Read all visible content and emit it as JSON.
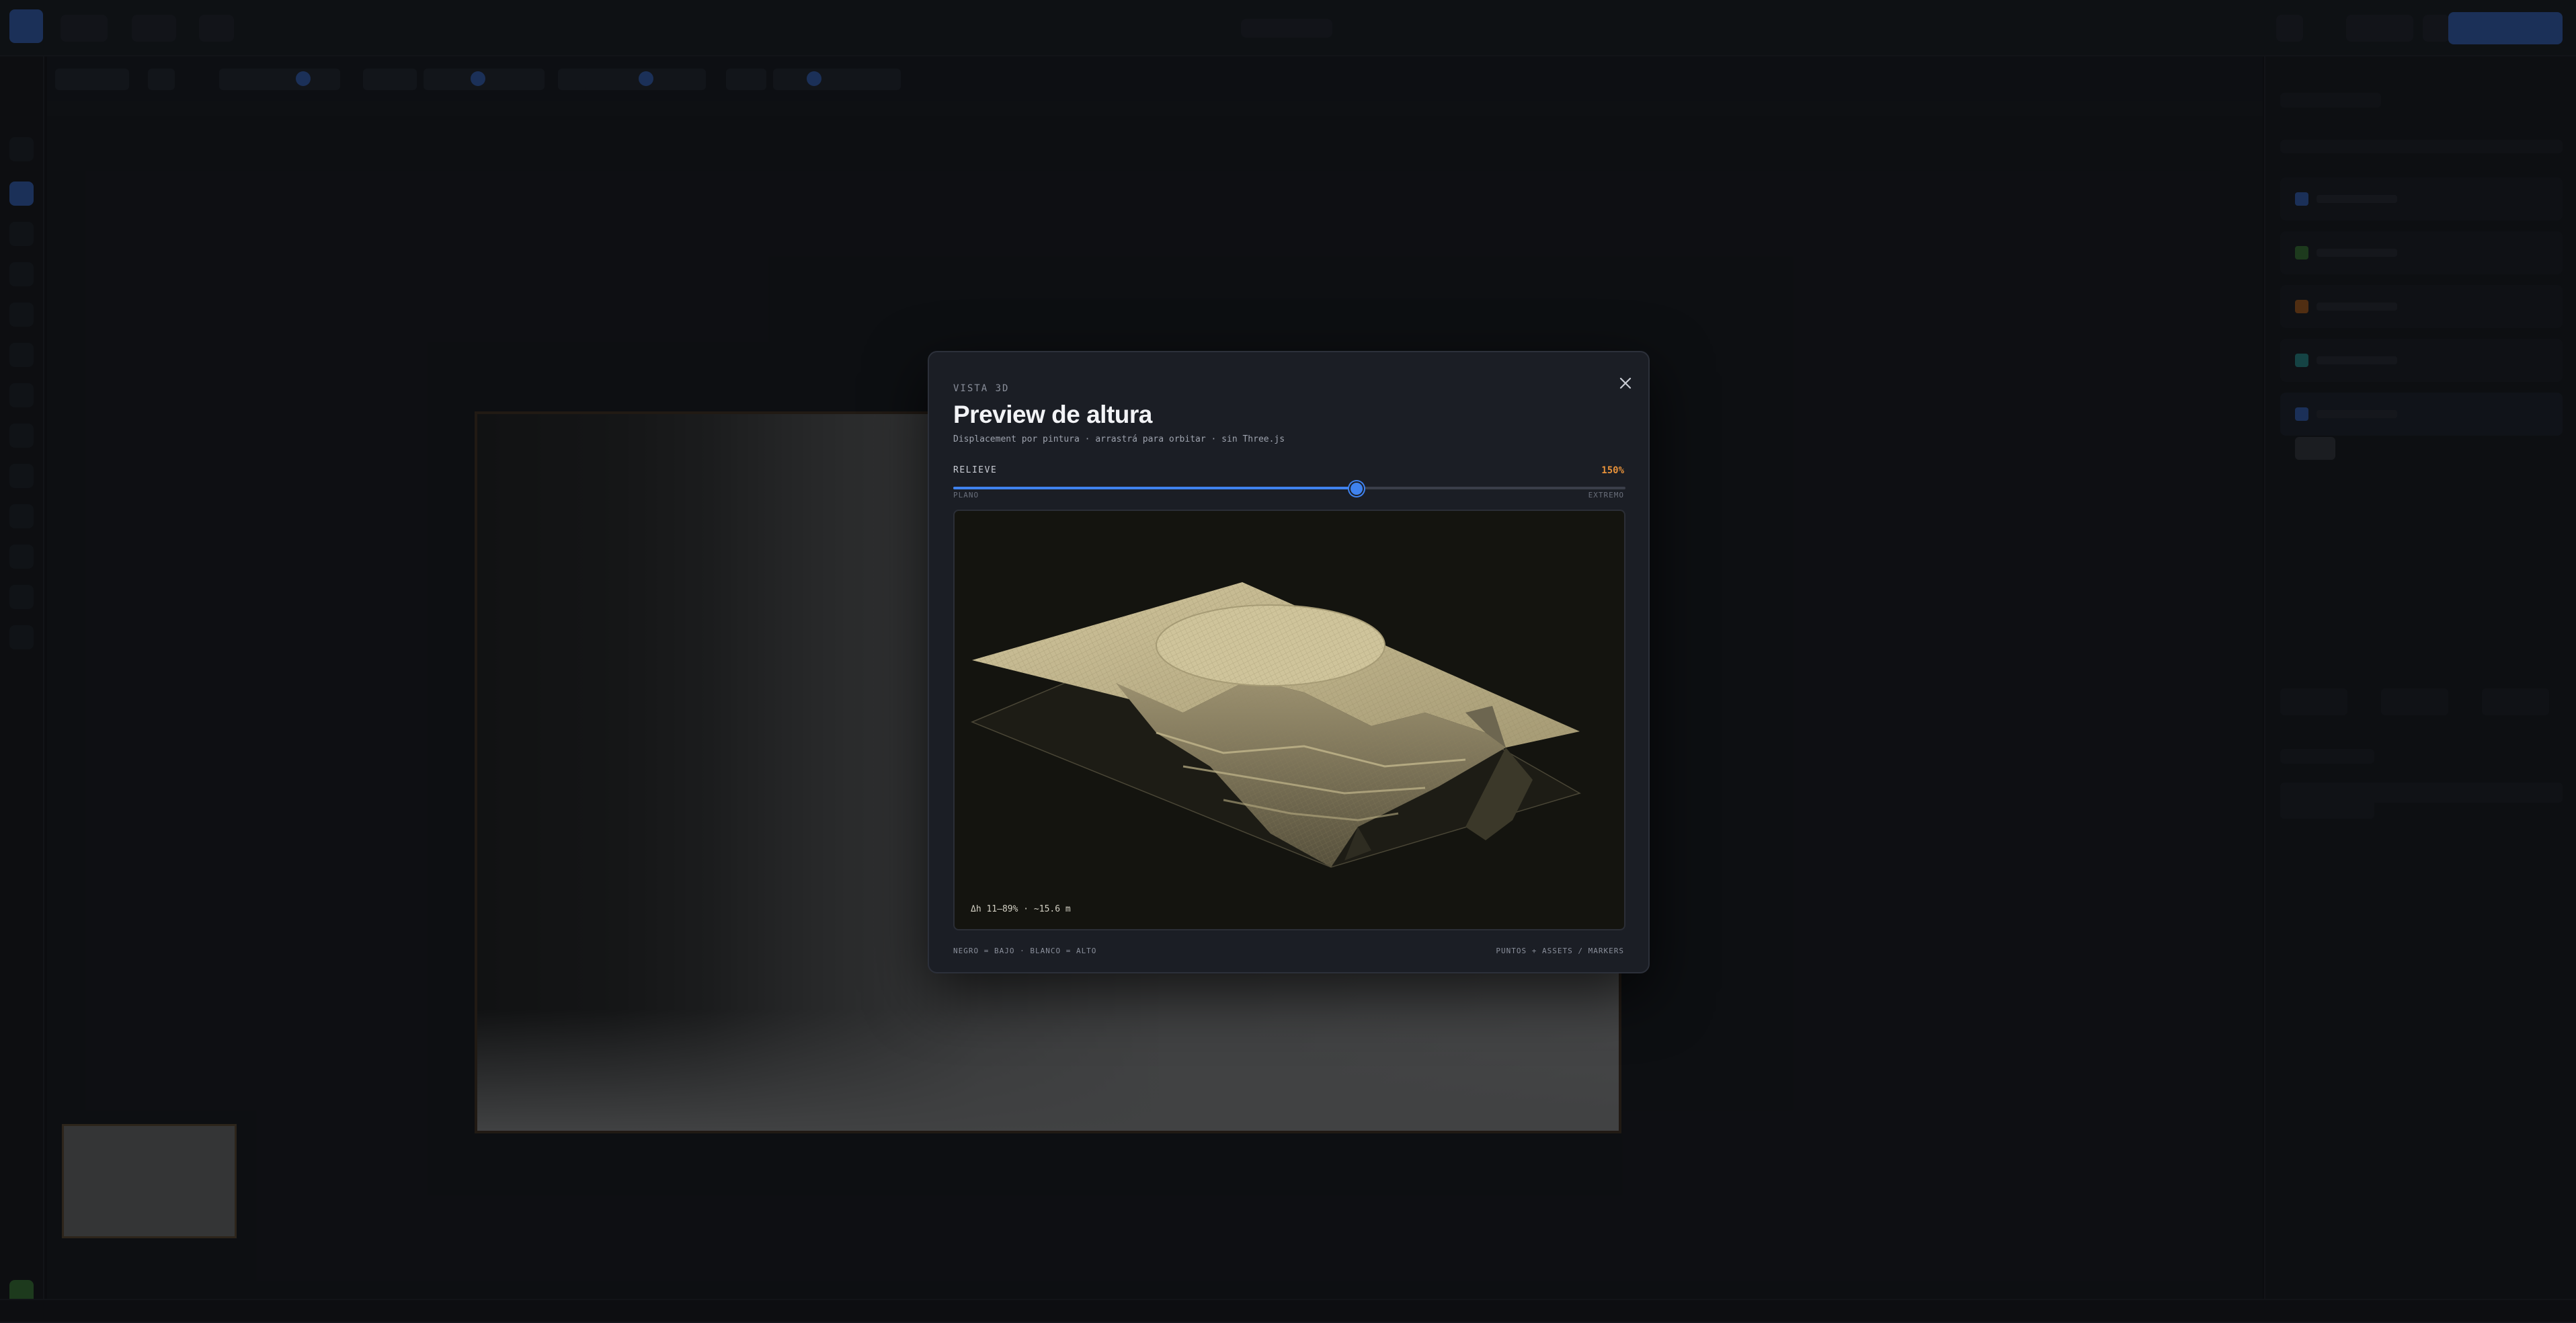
{
  "modal": {
    "eyebrow": "VISTA 3D",
    "title": "Preview de altura",
    "subtitle": "Displacement por pintura · arrastrá para orbitar · sin Three.js",
    "close_icon": "close-icon",
    "slider": {
      "label": "RELIEVE",
      "value_text": "150%",
      "fraction": 0.6,
      "min_label": "PLANO",
      "max_label": "EXTREMO",
      "accent": "#3f82ee"
    },
    "viewport": {
      "readout": "Δh 11–89% · ~15.6 m",
      "terrain_color": "#cbbd91"
    },
    "footer": {
      "left": "NEGRO = BAJO · BLANCO = ALTO",
      "right": "PUNTOS + ASSETS / MARKERS"
    }
  }
}
